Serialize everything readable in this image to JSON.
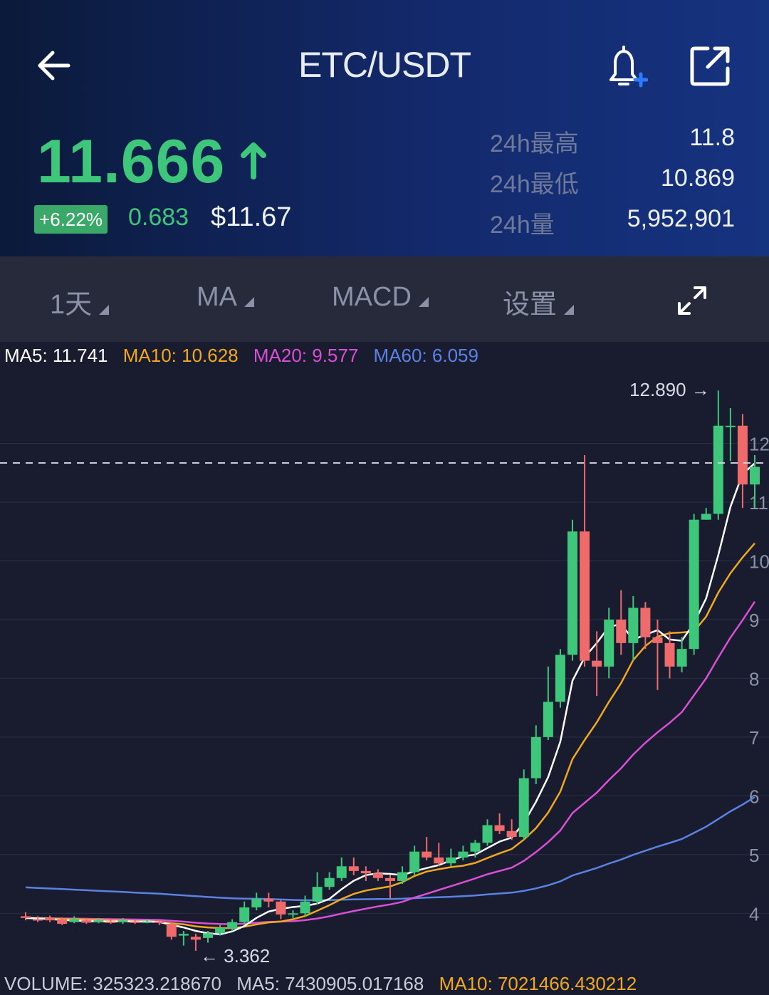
{
  "header": {
    "pair": "ETC/USDT",
    "price": "11.666",
    "change_pct": "+6.22%",
    "change_abs": "0.683",
    "price_usd": "$11.67",
    "stats": [
      {
        "label": "24h最高",
        "value": "11.8"
      },
      {
        "label": "24h最低",
        "value": "10.869"
      },
      {
        "label": "24h量",
        "value": "5,952,901"
      }
    ],
    "icons": {
      "back": "arrow-left-icon",
      "alert": "bell-plus-icon",
      "share": "share-icon",
      "trend": "arrow-up-icon"
    }
  },
  "toolbar": {
    "interval": "1天",
    "main_indicator": "MA",
    "sub_indicator": "MACD",
    "settings": "设置",
    "fullscreen_icon": "expand-icon"
  },
  "ma_legend": {
    "ma5": "MA5: 11.741",
    "ma10": "MA10: 10.628",
    "ma20": "MA20: 9.577",
    "ma60": "MA60: 6.059"
  },
  "volume_legend": {
    "volume": "VOLUME: 325323.218670",
    "ma5": "MA5: 7430905.017168",
    "ma10": "MA10: 7021466.430212"
  },
  "colors": {
    "up": "#3ec67a",
    "down": "#ef6a6a",
    "ma5": "#ffffff",
    "ma10": "#f0a91e",
    "ma20": "#d94fd6",
    "ma60": "#5b82e3"
  },
  "chart_data": {
    "type": "candlestick",
    "y_ticks": [
      "12",
      "11",
      "10",
      "9",
      "8",
      "7",
      "6",
      "5",
      "4"
    ],
    "ylim": [
      3.3,
      13.0
    ],
    "max_label": "12.890 →",
    "min_label": "← 3.362",
    "current_price_line": 11.666,
    "candles": [
      [
        3.95,
        3.92,
        4.02,
        3.88
      ],
      [
        3.9,
        3.88,
        3.95,
        3.85
      ],
      [
        3.92,
        3.88,
        3.96,
        3.85
      ],
      [
        3.9,
        3.82,
        3.93,
        3.8
      ],
      [
        3.85,
        3.9,
        3.95,
        3.83
      ],
      [
        3.88,
        3.84,
        3.92,
        3.82
      ],
      [
        3.85,
        3.88,
        3.92,
        3.83
      ],
      [
        3.86,
        3.84,
        3.9,
        3.82
      ],
      [
        3.85,
        3.88,
        3.92,
        3.82
      ],
      [
        3.86,
        3.84,
        3.88,
        3.82
      ],
      [
        3.85,
        3.86,
        3.9,
        3.83
      ],
      [
        3.86,
        3.84,
        3.88,
        3.8
      ],
      [
        3.82,
        3.6,
        3.85,
        3.55
      ],
      [
        3.62,
        3.65,
        3.7,
        3.45
      ],
      [
        3.6,
        3.55,
        3.65,
        3.36
      ],
      [
        3.58,
        3.66,
        3.7,
        3.5
      ],
      [
        3.66,
        3.75,
        3.8,
        3.62
      ],
      [
        3.74,
        3.85,
        3.9,
        3.7
      ],
      [
        3.85,
        4.1,
        4.2,
        3.82
      ],
      [
        4.1,
        4.25,
        4.35,
        4.05
      ],
      [
        4.25,
        4.2,
        4.35,
        4.1
      ],
      [
        4.2,
        3.98,
        4.22,
        3.9
      ],
      [
        3.98,
        4.0,
        4.05,
        3.92
      ],
      [
        4.0,
        4.2,
        4.3,
        3.95
      ],
      [
        4.2,
        4.45,
        4.7,
        4.15
      ],
      [
        4.45,
        4.6,
        4.7,
        4.4
      ],
      [
        4.6,
        4.8,
        4.95,
        4.55
      ],
      [
        4.8,
        4.72,
        4.95,
        4.65
      ],
      [
        4.72,
        4.68,
        4.8,
        4.55
      ],
      [
        4.68,
        4.6,
        4.75,
        4.55
      ],
      [
        4.6,
        4.55,
        4.65,
        4.25
      ],
      [
        4.55,
        4.7,
        4.8,
        4.5
      ],
      [
        4.7,
        5.05,
        5.15,
        4.65
      ],
      [
        5.05,
        4.95,
        5.3,
        4.9
      ],
      [
        4.95,
        4.85,
        5.2,
        4.8
      ],
      [
        4.85,
        4.95,
        5.1,
        4.8
      ],
      [
        4.95,
        5.05,
        5.15,
        4.9
      ],
      [
        5.05,
        5.2,
        5.25,
        4.95
      ],
      [
        5.2,
        5.5,
        5.6,
        5.15
      ],
      [
        5.5,
        5.4,
        5.7,
        5.35
      ],
      [
        5.4,
        5.3,
        5.6,
        5.25
      ],
      [
        5.3,
        6.3,
        6.45,
        5.25
      ],
      [
        6.3,
        7.0,
        7.2,
        6.2
      ],
      [
        7.0,
        7.6,
        8.2,
        6.95
      ],
      [
        7.6,
        8.4,
        8.5,
        7.5
      ],
      [
        8.4,
        10.5,
        10.7,
        8.3
      ],
      [
        10.5,
        8.3,
        11.8,
        8.2
      ],
      [
        8.3,
        8.2,
        8.8,
        7.7
      ],
      [
        8.2,
        9.0,
        9.2,
        8.0
      ],
      [
        9.0,
        8.6,
        9.5,
        8.4
      ],
      [
        8.6,
        9.2,
        9.4,
        8.3
      ],
      [
        9.2,
        8.7,
        9.3,
        8.5
      ],
      [
        8.7,
        8.6,
        9.0,
        7.8
      ],
      [
        8.6,
        8.2,
        8.8,
        8.0
      ],
      [
        8.2,
        8.5,
        8.7,
        8.1
      ],
      [
        8.5,
        10.7,
        10.8,
        8.4
      ],
      [
        10.7,
        10.8,
        10.9,
        10.7
      ],
      [
        10.8,
        12.3,
        12.9,
        10.7
      ],
      [
        12.3,
        12.3,
        12.6,
        11.7
      ],
      [
        12.3,
        11.3,
        12.5,
        10.9
      ],
      [
        11.3,
        11.6,
        11.8,
        10.9
      ]
    ],
    "ma5_last": 11.741,
    "ma10_last": 10.628,
    "ma20_last": 9.577,
    "ma60_last": 6.059
  }
}
